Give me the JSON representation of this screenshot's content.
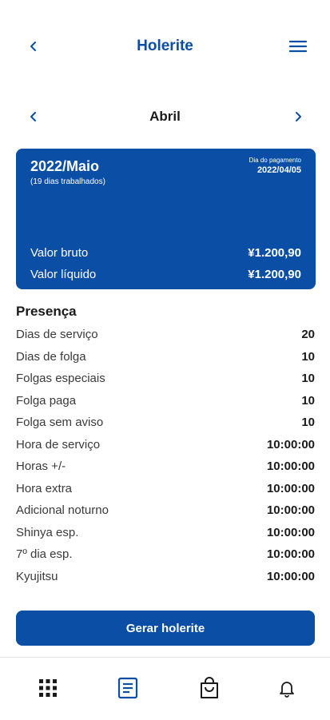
{
  "header": {
    "title": "Holerite",
    "back_icon": "chevron-left-icon",
    "menu_icon": "hamburger-menu-icon"
  },
  "month_nav": {
    "label": "Abril",
    "prev_icon": "chevron-left-icon",
    "next_icon": "chevron-right-icon"
  },
  "card": {
    "period": "2022/Maio",
    "days_worked": "(19 dias trabalhados)",
    "payment_label": "Dia do pagamento",
    "payment_date": "2022/04/05",
    "gross_label": "Valor bruto",
    "gross_value": "¥1.200,90",
    "net_label": "Valor líquido",
    "net_value": "¥1.200,90"
  },
  "presence": {
    "title": "Presença",
    "rows": [
      {
        "label": "Dias de serviço",
        "value": "20"
      },
      {
        "label": "Dias de folga",
        "value": "10"
      },
      {
        "label": "Folgas especiais",
        "value": "10"
      },
      {
        "label": "Folga paga",
        "value": "10"
      },
      {
        "label": "Folga sem aviso",
        "value": "10"
      },
      {
        "label": "Hora de serviço",
        "value": "10:00:00"
      },
      {
        "label": "Horas +/-",
        "value": "10:00:00"
      },
      {
        "label": "Hora extra",
        "value": "10:00:00"
      },
      {
        "label": "Adicional noturno",
        "value": "10:00:00"
      },
      {
        "label": "Shinya esp.",
        "value": "10:00:00"
      },
      {
        "label": "7º dia esp.",
        "value": "10:00:00"
      },
      {
        "label": "Kyujitsu",
        "value": "10:00:00"
      }
    ]
  },
  "actions": {
    "generate_label": "Gerar holerite"
  },
  "bottom_nav": {
    "items": [
      {
        "icon": "apps-grid-icon"
      },
      {
        "icon": "payslip-document-icon",
        "active": true
      },
      {
        "icon": "shopping-bag-icon"
      },
      {
        "icon": "bell-icon"
      }
    ]
  },
  "colors": {
    "primary": "#0a4ea6",
    "text": "#1a1a1a",
    "secondary_text": "#3a3a3a"
  }
}
